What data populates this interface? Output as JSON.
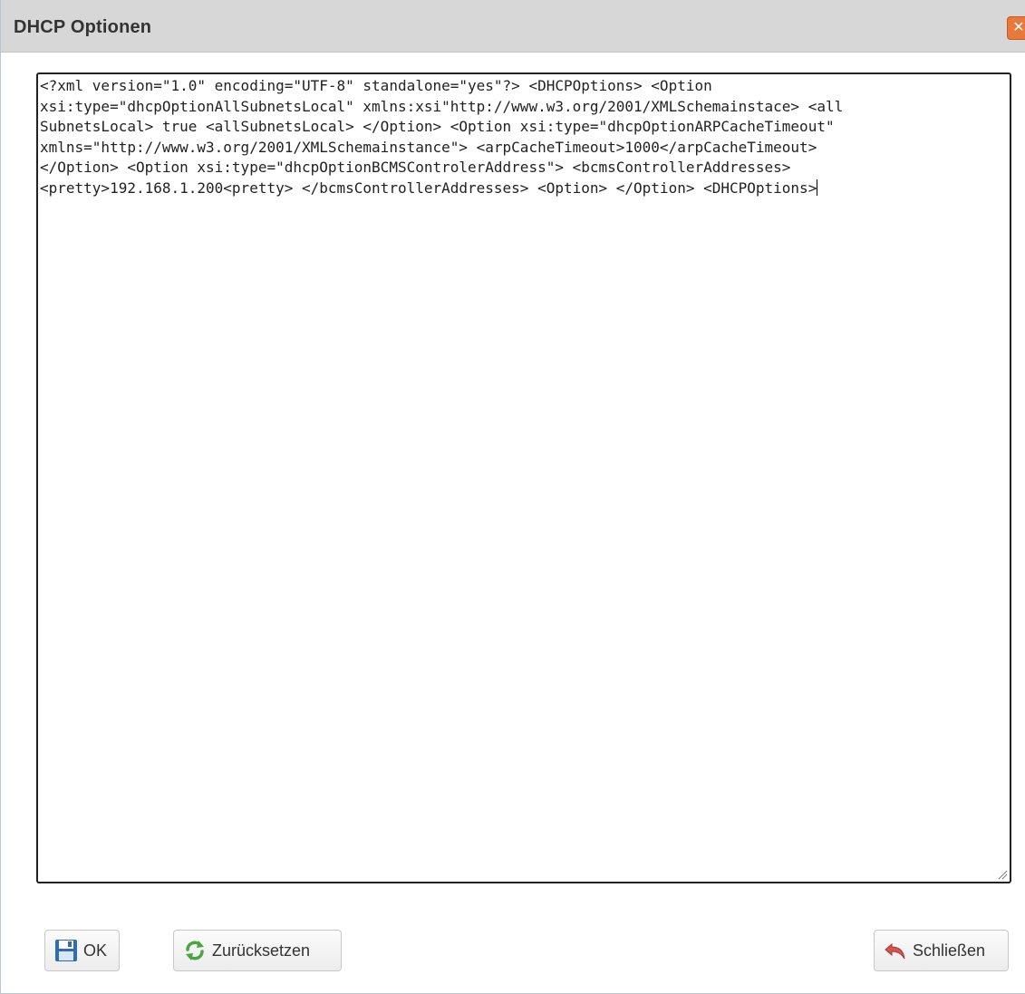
{
  "dialog": {
    "title": "DHCP Optionen",
    "close_icon": "close-icon"
  },
  "editor": {
    "lines": [
      "<?xml version=\"1.0\" encoding=\"UTF-8\" standalone=\"yes\"?> <DHCPOptions> <Option",
      "xsi:type=\"dhcpOptionAllSubnetsLocal\" xmlns:xsi\"http://www.w3.org/2001/XMLSchemainstace> <all",
      "SubnetsLocal> true <allSubnetsLocal> </Option> <Option xsi:type=\"dhcpOptionARPCacheTimeout\"",
      "xmlns=\"http://www.w3.org/2001/XMLSchemainstance\"> <arpCacheTimeout>1000</arpCacheTimeout>",
      "</Option> <Option xsi:type=\"dhcpOptionBCMSControlerAddress\"> <bcmsControllerAddresses>",
      "<pretty>192.168.1.200<pretty> </bcmsControllerAddresses> <Option> </Option> <DHCPOptions>"
    ]
  },
  "buttons": {
    "ok_label": "OK",
    "ok_icon": "save-icon",
    "reset_label": "Zurücksetzen",
    "reset_icon": "refresh-icon",
    "close_label": "Schließen",
    "close_icon": "undo-arrow-icon"
  },
  "colors": {
    "titlebar": "#d7d7d7",
    "close_button": "#e8793a",
    "editor_border": "#222222",
    "spellcheck_underline": "#d00000"
  }
}
